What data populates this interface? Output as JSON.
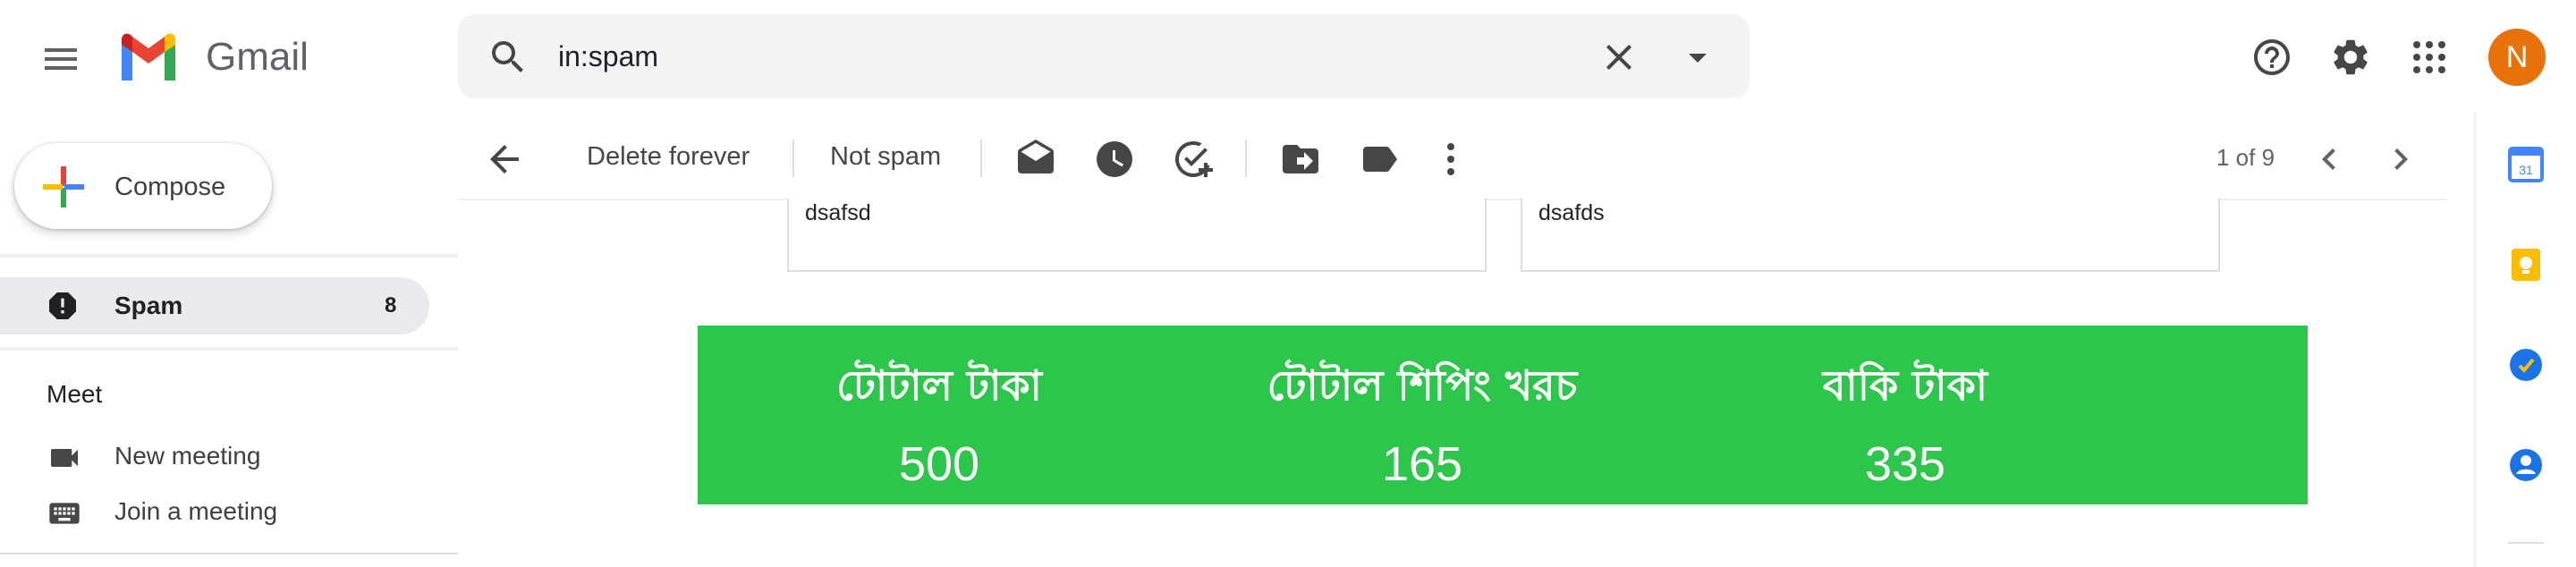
{
  "app": {
    "name": "Gmail"
  },
  "search": {
    "value": "in:spam",
    "placeholder": "Search mail"
  },
  "header": {
    "avatar_initial": "N",
    "avatar_color": "#e8710a"
  },
  "sidebar": {
    "compose_label": "Compose",
    "spam": {
      "label": "Spam",
      "count": "8"
    },
    "meet": {
      "heading": "Meet",
      "items": [
        {
          "label": "New meeting",
          "icon": "video-camera-icon"
        },
        {
          "label": "Join a meeting",
          "icon": "keyboard-icon"
        }
      ]
    }
  },
  "toolbar": {
    "delete_forever_label": "Delete forever",
    "not_spam_label": "Not spam",
    "icons": [
      "back-arrow-icon",
      "mark-unread-icon",
      "snooze-icon",
      "add-task-icon",
      "move-to-icon",
      "label-icon",
      "more-vert-icon"
    ],
    "pager": "1 of 9"
  },
  "email": {
    "cards": [
      {
        "text": "dsafsd"
      },
      {
        "text": "dsafds"
      }
    ],
    "summary": {
      "background": "#2cc64a",
      "columns": [
        {
          "label": "টোটাল টাকা",
          "value": "500"
        },
        {
          "label": "টোটাল শিপিং খরচ",
          "value": "165"
        },
        {
          "label": "বাকি টাকা",
          "value": "335"
        }
      ]
    }
  },
  "side_panel": {
    "icons": [
      "calendar-icon",
      "keep-icon",
      "tasks-icon",
      "contacts-icon"
    ],
    "calendar_day": "31"
  }
}
